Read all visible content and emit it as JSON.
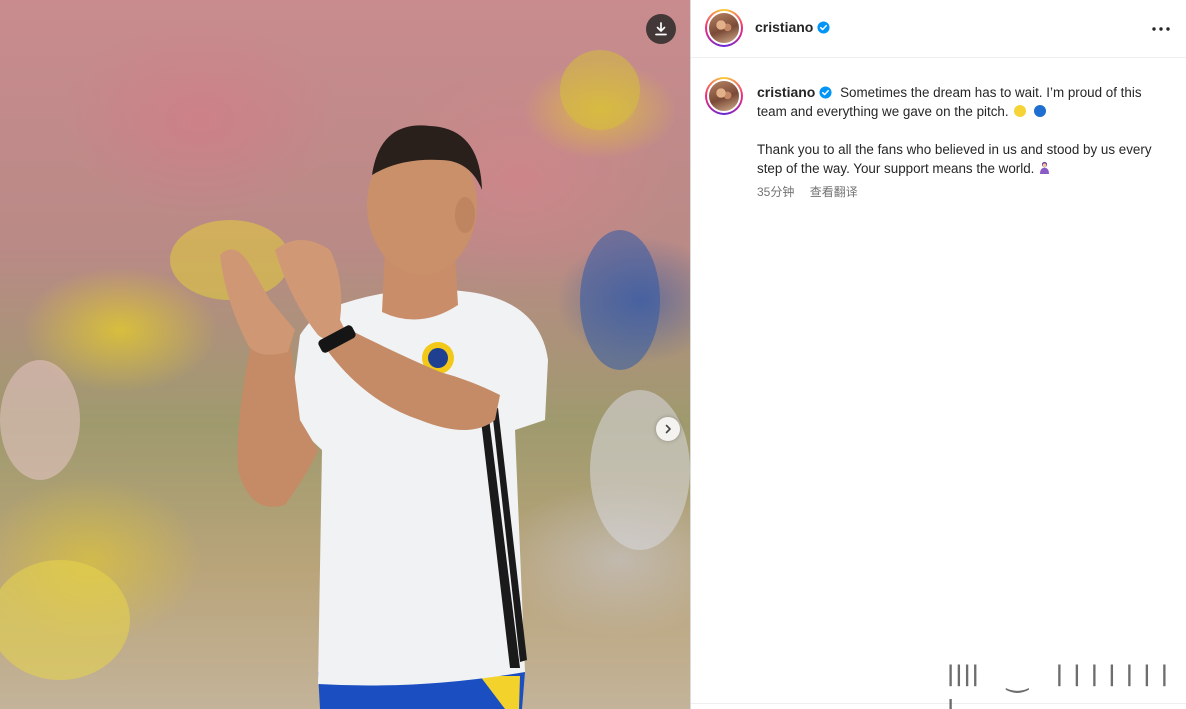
{
  "post": {
    "image_alt": "",
    "download_icon": "download-icon",
    "next_icon": "chevron-right-icon"
  },
  "header": {
    "username": "cristiano",
    "verified_icon": "verified-badge-icon",
    "more_icon": "more-horizontal-icon"
  },
  "caption": {
    "username": "cristiano",
    "paragraph1": "Sometimes the dream has to wait. I’m proud of this team and everything we gave on the pitch.",
    "paragraph2": "Thank you to all the fans who believed in us and stood by us every step of the way. Your support means the world.",
    "emojis": [
      "yellow-circle",
      "blue-circle",
      "woman-bowing"
    ],
    "timestamp": "35分钟",
    "translate_label": "查看翻译"
  },
  "watermark": {
    "text": "llll　‿　l l l l l l l l"
  },
  "colors": {
    "verified_blue": "#0095f6",
    "text_primary": "#262626",
    "text_secondary": "#737373",
    "emoji_yellow": "#f6d337",
    "emoji_blue": "#1e6fd0"
  }
}
